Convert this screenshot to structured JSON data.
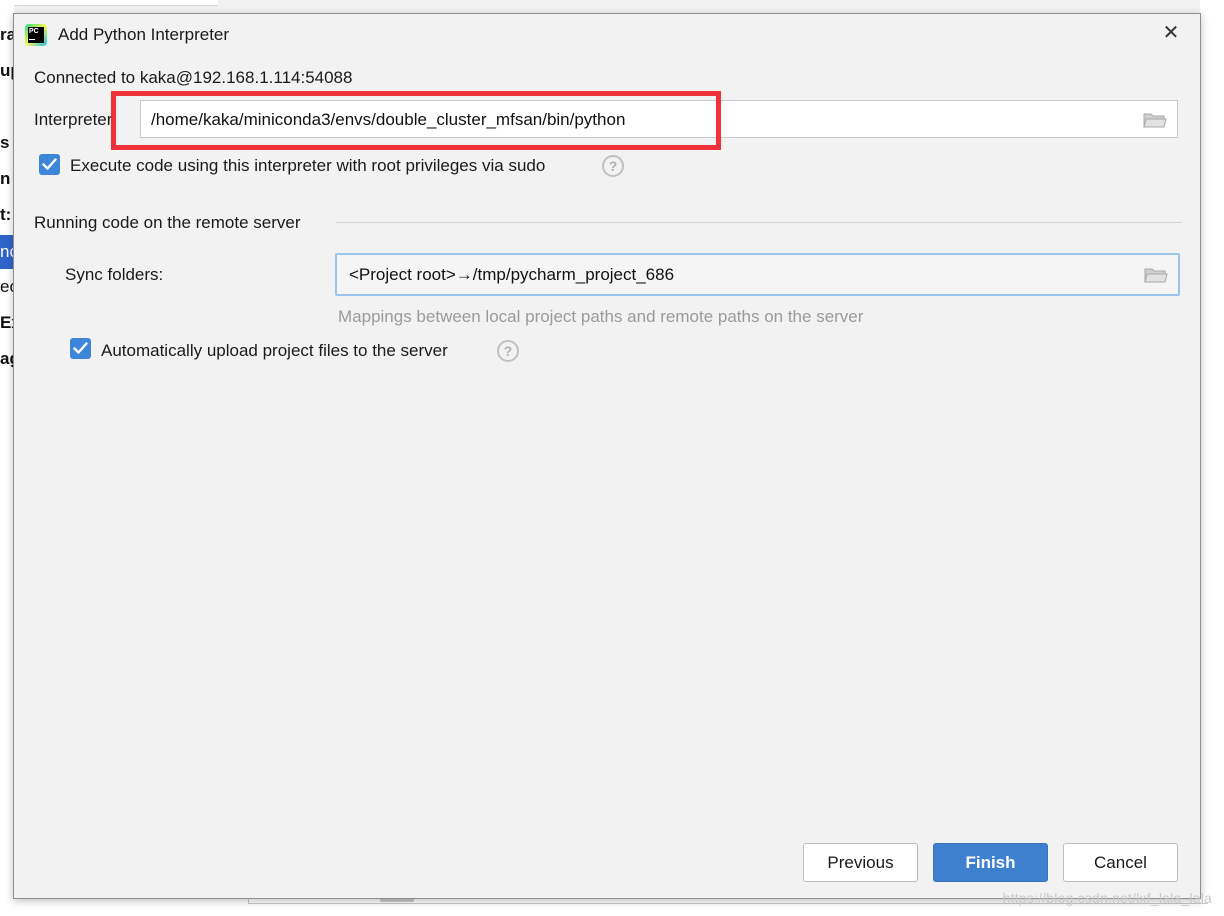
{
  "background": {
    "left_fragments": [
      "ra",
      "up",
      "s",
      "n",
      "t:",
      "nc",
      "ec",
      "Ex",
      "ag"
    ],
    "watermark": "https://blog.csdn.net/lxf_lala_lala"
  },
  "dialog": {
    "title": "Add Python Interpreter",
    "close_glyph": "✕",
    "connected_text": "Connected to kaka@192.168.1.114:54088",
    "interpreter": {
      "label": "Interpreter:",
      "value": "/home/kaka/miniconda3/envs/double_cluster_mfsan/bin/python"
    },
    "sudo_checkbox": {
      "label": "Execute code using this interpreter with root privileges via sudo",
      "checked": true
    },
    "remote_section": {
      "title": "Running code on the remote server",
      "sync_folders": {
        "label": "Sync folders:",
        "value": "<Project root>→/tmp/pycharm_project_686",
        "hint": "Mappings between local project paths and remote paths on the server"
      },
      "auto_upload_checkbox": {
        "label": "Automatically upload project files to the server",
        "checked": true
      }
    },
    "help_glyph": "?",
    "buttons": {
      "previous": "Previous",
      "finish": "Finish",
      "cancel": "Cancel"
    }
  },
  "colors": {
    "accent": "#3d85d9",
    "primary_button": "#3f7fcf",
    "highlight_box": "#f0333a",
    "dialog_bg": "#f2f2f2"
  }
}
